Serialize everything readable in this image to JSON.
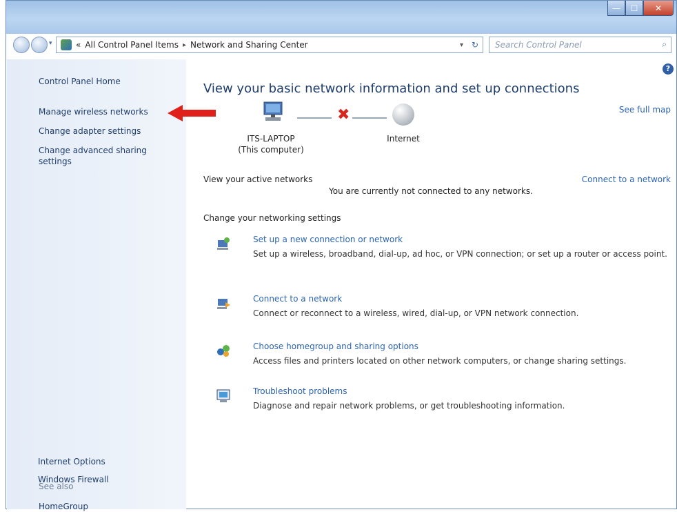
{
  "window": {
    "controls": {
      "minimize": "—",
      "maximize": "☐",
      "close": "✕"
    }
  },
  "navbar": {
    "breadcrumb_root": "«",
    "breadcrumb": [
      "All Control Panel Items",
      "Network and Sharing Center"
    ],
    "search_placeholder": "Search Control Panel"
  },
  "sidebar": {
    "home": "Control Panel Home",
    "links": [
      "Manage wireless networks",
      "Change adapter settings",
      "Change advanced sharing",
      "settings"
    ],
    "see_also_title": "See also",
    "see_also": [
      "HomeGroup",
      "Internet Options",
      "Windows Firewall"
    ]
  },
  "main": {
    "title": "View your basic network information and set up connections",
    "see_full_map": "See full map",
    "computer_name": "ITS-LAPTOP",
    "computer_sub": "(This computer)",
    "internet_label": "Internet",
    "active_networks_label": "View your active networks",
    "connect_to_network": "Connect to a network",
    "not_connected": "You are currently not connected to any networks.",
    "change_settings_label": "Change your networking settings",
    "tasks": [
      {
        "link": "Set up a new connection or network",
        "desc": "Set up a wireless, broadband, dial-up, ad hoc, or VPN connection; or set up a router or access point.",
        "icon": "new-connection-icon"
      },
      {
        "link": "Connect to a network",
        "desc": "Connect or reconnect to a wireless, wired, dial-up, or VPN network connection.",
        "icon": "connect-network-icon"
      },
      {
        "link": "Choose homegroup and sharing options",
        "desc": "Access files and printers located on other network computers, or change sharing settings.",
        "icon": "homegroup-icon"
      },
      {
        "link": "Troubleshoot problems",
        "desc": "Diagnose and repair network problems, or get troubleshooting information.",
        "icon": "troubleshoot-icon"
      }
    ]
  },
  "colors": {
    "link": "#2c64b0",
    "sidebar_link": "#1e3d6b",
    "arrow": "#e0201a",
    "error_x": "#d8261e"
  }
}
